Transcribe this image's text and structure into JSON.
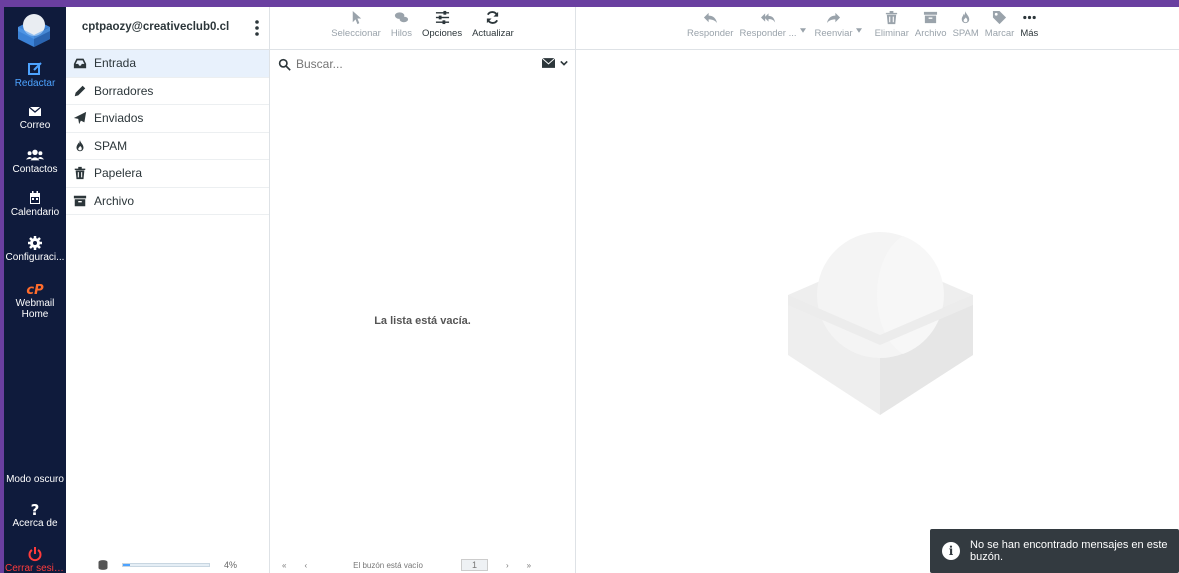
{
  "account": {
    "email": "cptpaozy@creativeclub0.cl"
  },
  "nav": [
    {
      "label": "Redactar"
    },
    {
      "label": "Correo"
    },
    {
      "label": "Contactos"
    },
    {
      "label": "Calendario"
    },
    {
      "label": "Configuraci..."
    },
    {
      "label": "Webmail Home"
    },
    {
      "label": "Modo oscuro"
    },
    {
      "label": "Acerca de"
    },
    {
      "label": "Cerrar sesión"
    }
  ],
  "folders": [
    {
      "label": "Entrada",
      "icon": "inbox-icon"
    },
    {
      "label": "Borradores",
      "icon": "pencil-icon"
    },
    {
      "label": "Enviados",
      "icon": "paper-plane-icon"
    },
    {
      "label": "SPAM",
      "icon": "fire-icon"
    },
    {
      "label": "Papelera",
      "icon": "trash-icon"
    },
    {
      "label": "Archivo",
      "icon": "archive-icon"
    }
  ],
  "quota": {
    "percent_label": "4%",
    "fraction": 0.04
  },
  "list_toolbar": {
    "select": "Seleccionar",
    "threads": "Hilos",
    "options": "Opciones",
    "refresh": "Actualizar"
  },
  "search": {
    "placeholder": "Buscar..."
  },
  "list": {
    "empty_text": "La lista está vacía.",
    "footer_text": "El buzón está vacío",
    "page": "1",
    "first": "«",
    "prev": "‹",
    "next": "›",
    "last": "»"
  },
  "main_toolbar": {
    "reply": "Responder",
    "reply_all": "Responder ...",
    "forward": "Reenviar",
    "delete": "Eliminar",
    "archive": "Archivo",
    "spam": "SPAM",
    "mark": "Marcar",
    "more": "Más"
  },
  "toast": {
    "text": "No se han encontrado mensajes en este buzón."
  },
  "colors": {
    "nav_bg": "#0f1b3c",
    "accent": "#4da3ff",
    "logout": "#ff3b3b",
    "cpanel": "#ff6c2c"
  }
}
